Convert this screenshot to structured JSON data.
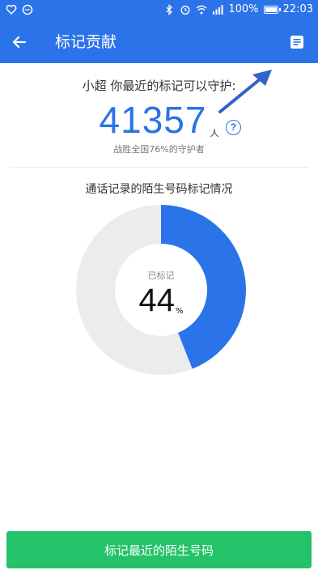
{
  "status_bar": {
    "battery": "100%",
    "time": "22:03",
    "battery_level": 1.0
  },
  "app_bar": {
    "title": "标记贡献",
    "back_icon": "back-arrow-icon",
    "action_icon": "document-icon"
  },
  "summary": {
    "guard_text": "小超 你最近的标记可以守护:",
    "count": "41357",
    "unit": "人",
    "help": "?",
    "beat_text": "战胜全国76%的守护者"
  },
  "chart_section": {
    "title": "通话记录的陌生号码标记情况"
  },
  "chart_data": {
    "type": "pie",
    "categories": [
      "已标记",
      ""
    ],
    "values": [
      44,
      56
    ],
    "center_label": "已标记",
    "center_value": "44",
    "center_unit": "%",
    "colors": [
      "#2b73e8",
      "#ececec"
    ]
  },
  "footer": {
    "cta_label": "标记最近的陌生号码"
  },
  "colors": {
    "primary": "#2b73e8",
    "cta": "#24c269",
    "track": "#ececec"
  }
}
